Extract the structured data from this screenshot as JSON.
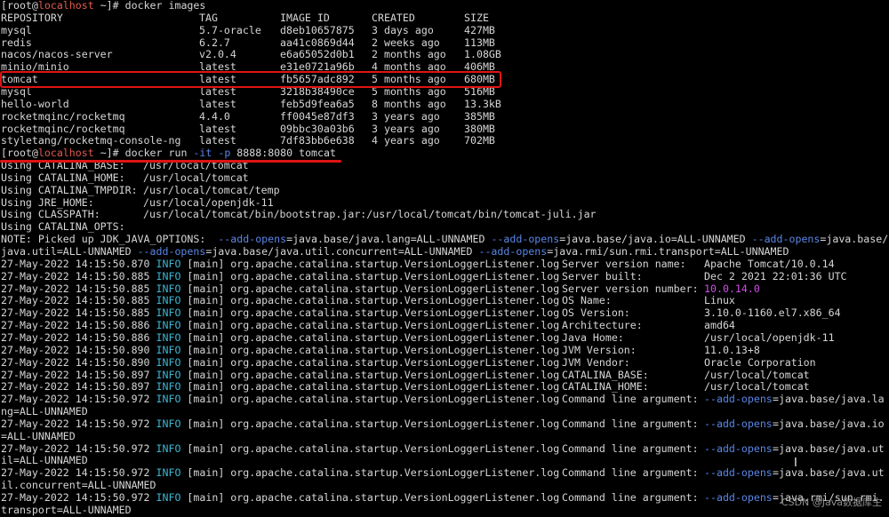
{
  "prompt": {
    "user": "root",
    "host": "localhost",
    "cwd": "~"
  },
  "commands": {
    "images": "docker images",
    "run_prefix": "docker run ",
    "run_flag_it": "-it",
    "run_flag_p": "-p",
    "run_suffix": " 8888:8080 tomcat"
  },
  "images_table": {
    "headers": [
      "REPOSITORY",
      "TAG",
      "IMAGE ID",
      "CREATED",
      "SIZE"
    ],
    "rows": [
      [
        "mysql",
        "5.7-oracle",
        "d8eb10657875",
        "3 days ago",
        "427MB"
      ],
      [
        "redis",
        "6.2.7",
        "aa41c0869d44",
        "2 weeks ago",
        "113MB"
      ],
      [
        "nacos/nacos-server",
        "v2.0.4",
        "e6a65052d0b1",
        "2 months ago",
        "1.08GB"
      ],
      [
        "minio/minio",
        "latest",
        "e31e0721a96b",
        "4 months ago",
        "406MB"
      ],
      [
        "tomcat",
        "latest",
        "fb5657adc892",
        "5 months ago",
        "680MB"
      ],
      [
        "mysql",
        "latest",
        "3218b38490ce",
        "5 months ago",
        "516MB"
      ],
      [
        "hello-world",
        "latest",
        "feb5d9fea6a5",
        "8 months ago",
        "13.3kB"
      ],
      [
        "rocketmqinc/rocketmq",
        "4.4.0",
        "ff0045e87df3",
        "3 years ago",
        "385MB"
      ],
      [
        "rocketmqinc/rocketmq",
        "latest",
        "09bbc30a03b6",
        "3 years ago",
        "380MB"
      ],
      [
        "styletang/rocketmq-console-ng",
        "latest",
        "7df83bb6e638",
        "4 years ago",
        "702MB"
      ]
    ]
  },
  "env": [
    [
      "Using CATALINA_BASE:",
      "/usr/local/tomcat"
    ],
    [
      "Using CATALINA_HOME:",
      "/usr/local/tomcat"
    ],
    [
      "Using CATALINA_TMPDIR:",
      "/usr/local/tomcat/temp"
    ],
    [
      "Using JRE_HOME:",
      "/usr/local/openjdk-11"
    ],
    [
      "Using CLASSPATH:",
      "/usr/local/tomcat/bin/bootstrap.jar:/usr/local/tomcat/bin/tomcat-juli.jar"
    ],
    [
      "Using CATALINA_OPTS:",
      ""
    ]
  ],
  "note": {
    "prefix": "NOTE: Picked up JDK_JAVA_OPTIONS:  ",
    "flag": "--add-opens",
    "values": [
      "=java.base/java.lang=ALL-UNNAMED ",
      "=java.base/java.io=ALL-UNNAMED ",
      "=java.base/"
    ],
    "line2": [
      "java.util=ALL-UNNAMED ",
      "=java.base/java.util.concurrent=ALL-UNNAMED ",
      "=java.rmi/sun.rmi.transport=ALL-UNNAMED"
    ]
  },
  "log": {
    "level": "INFO",
    "thread": "[main]",
    "logger": "org.apache.catalina.startup.VersionLoggerListener.log",
    "entries": [
      {
        "ts": "27-May-2022 14:15:50.870",
        "key": "Server version name:",
        "val": "Apache Tomcat/10.0.14"
      },
      {
        "ts": "27-May-2022 14:15:50.885",
        "key": "Server built:",
        "val": "Dec 2 2021 22:01:36 UTC"
      },
      {
        "ts": "27-May-2022 14:15:50.885",
        "key": "Server version number:",
        "val": "10.0.14.0"
      },
      {
        "ts": "27-May-2022 14:15:50.885",
        "key": "OS Name:",
        "val": "Linux"
      },
      {
        "ts": "27-May-2022 14:15:50.885",
        "key": "OS Version:",
        "val": "3.10.0-1160.el7.x86_64"
      },
      {
        "ts": "27-May-2022 14:15:50.886",
        "key": "Architecture:",
        "val": "amd64"
      },
      {
        "ts": "27-May-2022 14:15:50.886",
        "key": "Java Home:",
        "val": "/usr/local/openjdk-11"
      },
      {
        "ts": "27-May-2022 14:15:50.890",
        "key": "JVM Version:",
        "val": "11.0.13+8"
      },
      {
        "ts": "27-May-2022 14:15:50.890",
        "key": "JVM Vendor:",
        "val": "Oracle Corporation"
      },
      {
        "ts": "27-May-2022 14:15:50.897",
        "key": "CATALINA_BASE:",
        "val": "/usr/local/tomcat"
      },
      {
        "ts": "27-May-2022 14:15:50.897",
        "key": "CATALINA_HOME:",
        "val": "/usr/local/tomcat"
      }
    ],
    "cmd_key": "Command line argument:",
    "cmd_entries": [
      {
        "ts": "27-May-2022 14:15:50.972",
        "v1": "=java.base/java.la",
        "wrap": "ng=ALL-UNNAMED"
      },
      {
        "ts": "27-May-2022 14:15:50.972",
        "v1": "=java.base/java.io",
        "wrap": "=ALL-UNNAMED"
      },
      {
        "ts": "27-May-2022 14:15:50.972",
        "v1": "=java.base/java.ut",
        "wrap": "il=ALL-UNNAMED"
      },
      {
        "ts": "27-May-2022 14:15:50.972",
        "v1": "=java.base/java.ut",
        "wrap": "il.concurrent=ALL-UNNAMED"
      },
      {
        "ts": "27-May-2022 14:15:50.972",
        "v1": "=java.rmi/sun.rmi.",
        "wrap": "transport=ALL-UNNAMED"
      }
    ]
  },
  "watermark": "CSDN @Java数据库生",
  "colors": {
    "background": "#000000",
    "text": "#d6d6d6",
    "hostname": "#e05a4f",
    "option": "#5a86e6",
    "info": "#3db5d1",
    "version_number": "#d050e6",
    "highlight": "#e01414"
  }
}
